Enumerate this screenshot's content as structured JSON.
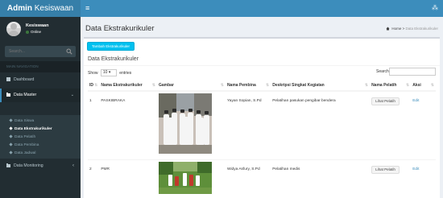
{
  "header": {
    "logo_bold": "Admin",
    "logo_light": " Kesiswaan",
    "menu_icon": "hamburger-icon",
    "collapse_icon": "sidebar-collapse-icon"
  },
  "sidebar": {
    "user": {
      "name": "Kesiswaan",
      "status": "Online",
      "status_color": "#3c763d"
    },
    "search_placeholder": "Search...",
    "nav_header": "MAIN NAVIGATION",
    "items": [
      {
        "label": "Dashboard",
        "icon": "dashboard-icon"
      },
      {
        "label": "Data Master",
        "icon": "folder-icon"
      },
      {
        "label": "Data Monitoring",
        "icon": "folder-icon"
      }
    ],
    "submenu": [
      {
        "label": "Data Siswa"
      },
      {
        "label": "Data Ekstrakurikuler"
      },
      {
        "label": "Data Pelatih"
      },
      {
        "label": "Data Pembina"
      },
      {
        "label": "Data Jadwal"
      }
    ]
  },
  "content": {
    "title": "Data Ekstrakurikuler",
    "breadcrumb": {
      "home": "Home",
      "current": "Data Ekstrakurikuler"
    },
    "add_button": "Tambah Ekstrakurikuler",
    "box_title": "Data Ekstrakurikuler",
    "show_label": "Show",
    "entries_value": "10",
    "entries_label": "entries",
    "search_label": "Search:"
  },
  "table": {
    "columns": [
      "ID",
      "Nama Ekstrakurikuler",
      "Gambar",
      "Nama Pembina",
      "Deskripsi Singkat Kegiatan",
      "Nama Pelatih",
      "Aksi"
    ],
    "rows": [
      {
        "id": "1",
        "name": "PASKIBRAKA",
        "pembina": "Yayan Sopian, S.Pd",
        "deskripsi": "Pelatihan pasukan pengibar bendera",
        "pelatih_button": "Lihat Pelatih",
        "aksi": "Edit"
      },
      {
        "id": "2",
        "name": "PMR",
        "pembina": "Widya Asfury, S.Pd",
        "deskripsi": "Pelatihan medis",
        "pelatih_button": "Lihat Pelatih",
        "aksi": "Edit"
      }
    ]
  },
  "colors": {
    "header_blue": "#3c8dbc",
    "logo_blue": "#367fa9",
    "sidebar_dark": "#222d32",
    "button_aqua": "#00c0ef",
    "link_blue": "#3c8dbc"
  }
}
